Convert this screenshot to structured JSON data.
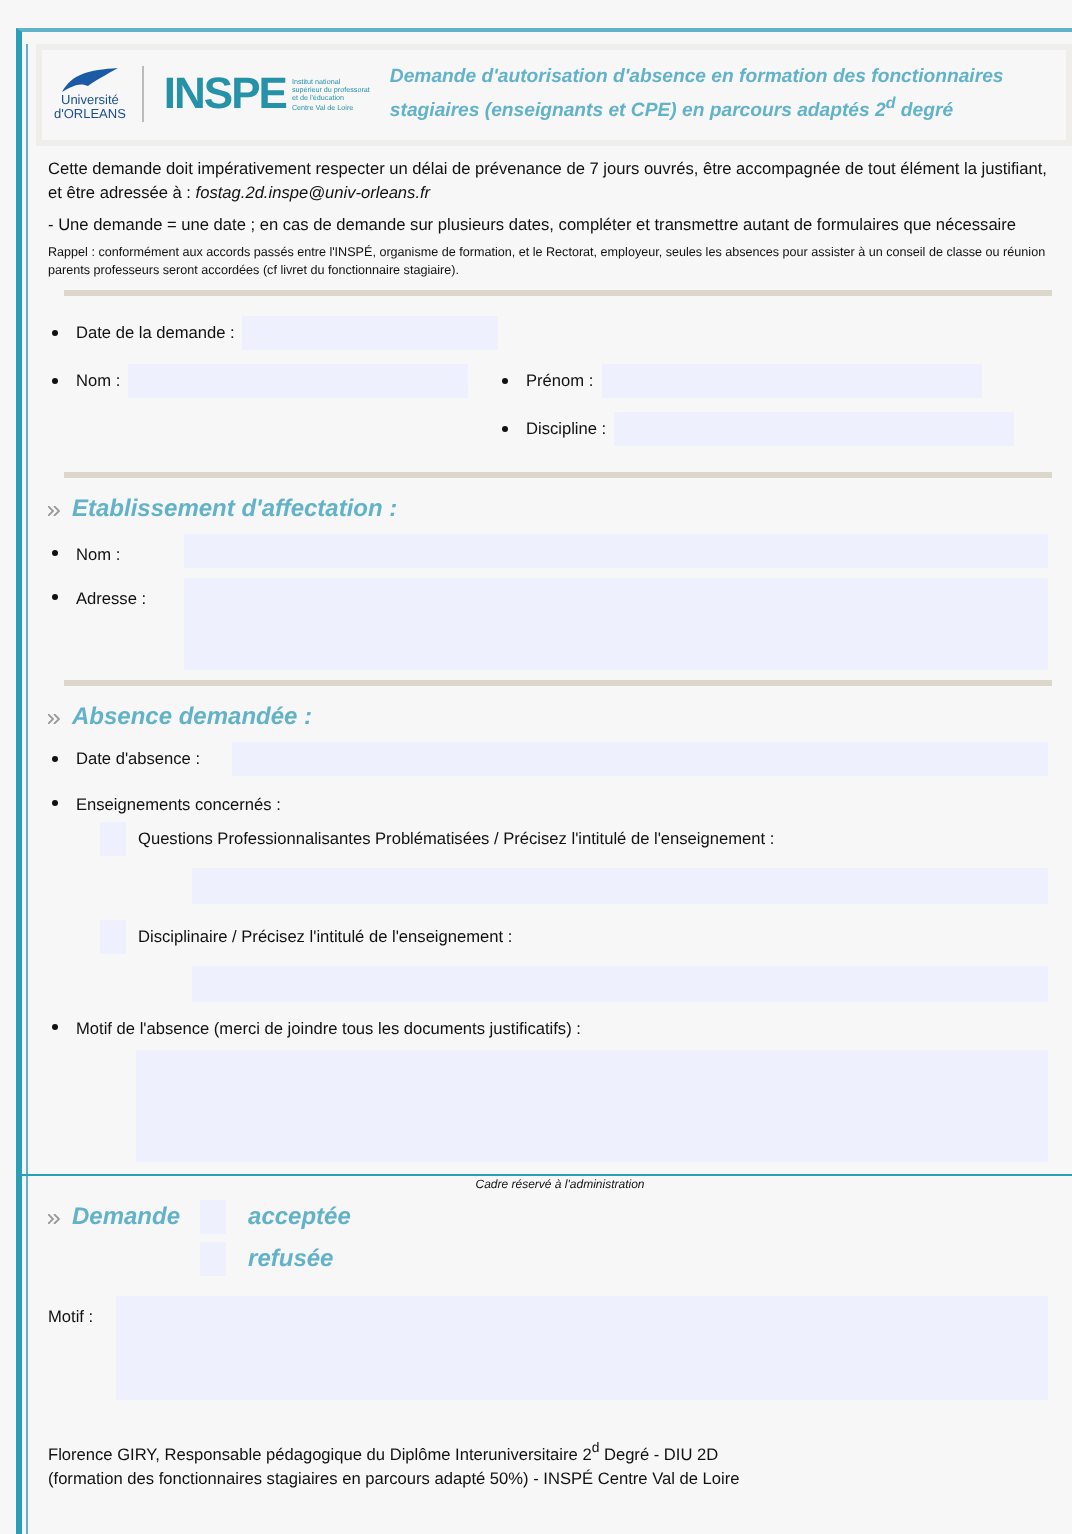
{
  "header": {
    "university_logo": [
      "Université",
      "d'ORLEANS"
    ],
    "inspe_logo": "INSPE",
    "inspe_caption": [
      "Institut national",
      "supérieur du professorat",
      "et de l'éducation",
      "Centre Val de Loire"
    ],
    "title": "Demande d'autorisation d'absence en formation des fonctionnaires stagiaires (enseignants et CPE) en parcours adaptés 2$^{d}$ degré"
  },
  "intro": [
    {
      "kind": "normal",
      "text": "Cette demande doit impérativement respecter un délai de prévenance de 7 jours ouvrés, être accompagnée de tout élément la justifiant, et être adressée à : *fostag.2d.inspe@univ-orleans.fr*"
    },
    {
      "kind": "normal",
      "text": "- Une demande = une date ; en cas de demande sur plusieurs dates, compléter et transmettre autant de formulaires que nécessaire"
    },
    {
      "kind": "small",
      "text": "Rappel : conformément aux accords passés entre l'INSPÉ, organisme de formation, et le Rectorat, employeur, seules les absences pour assister à un conseil de classe ou réunion parents professeurs seront accordées (cf livret du fonctionnaire stagiaire)."
    }
  ],
  "request_rows": [
    {
      "left": {
        "label": "Date de la demande :"
      }
    },
    {
      "left": {
        "label": "Nom :"
      },
      "right": {
        "label": "Prénom :"
      }
    },
    {
      "right": {
        "label": "Discipline :"
      }
    }
  ],
  "establishment": {
    "title": "Etablissement d'affectation :",
    "fields": [
      {
        "kind": "line",
        "label": "Nom :"
      },
      {
        "kind": "area",
        "label": "Adresse :"
      }
    ]
  },
  "absence": {
    "title": "Absence demandée :",
    "date_label": "Date d'absence :",
    "courses_label": "Enseignements concernés :",
    "courses": [
      {
        "label": "Questions Professionnalisantes Problématisées / Précisez l'intitulé de l'enseignement :",
        "checked": false
      },
      {
        "label": "Disciplinaire / Précisez l'intitulé de l'enseignement :",
        "checked": false
      }
    ],
    "reason_label": "Motif de l'absence (merci de joindre tous les documents justificatifs) :"
  },
  "admin": {
    "caption": "Cadre réservé à l'administration",
    "decision_label": "Demande",
    "options": [
      {
        "label": "acceptée",
        "checked": false
      },
      {
        "label": "refusée",
        "checked": false
      }
    ],
    "reason_label": "Motif :"
  },
  "footer": [
    "Florence GIRY, Responsable pédagogique du Diplôme Interuniversitaire 2$^{d}$ Degré - DIU 2D",
    "(formation des fonctionnaires stagiaires en parcours adapté 50%) - INSPÉ Centre Val de Loire"
  ]
}
